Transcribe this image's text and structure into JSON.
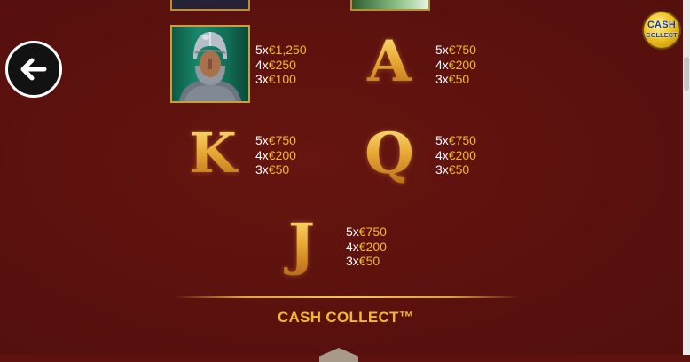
{
  "colors": {
    "background": "#5d1210",
    "gold_text": "#f3b92e",
    "white_text": "#ffffff",
    "divider": "#d9a640",
    "badge_gold": "#f2c21f",
    "badge_text": "#1b3d86"
  },
  "back_button": {
    "icon": "arrow-left-icon"
  },
  "badge": {
    "line1": "CASH",
    "line2": "COLLECT"
  },
  "symbols": {
    "knight": {
      "icon": "knight-helmet-icon",
      "payouts": [
        {
          "mult": "5x",
          "amount": "€1,250"
        },
        {
          "mult": "4x",
          "amount": "€250"
        },
        {
          "mult": "3x",
          "amount": "€100"
        }
      ]
    },
    "A": {
      "glyph": "A",
      "payouts": [
        {
          "mult": "5x",
          "amount": "€750"
        },
        {
          "mult": "4x",
          "amount": "€200"
        },
        {
          "mult": "3x",
          "amount": "€50"
        }
      ]
    },
    "K": {
      "glyph": "K",
      "payouts": [
        {
          "mult": "5x",
          "amount": "€750"
        },
        {
          "mult": "4x",
          "amount": "€200"
        },
        {
          "mult": "3x",
          "amount": "€50"
        }
      ]
    },
    "Q": {
      "glyph": "Q",
      "payouts": [
        {
          "mult": "5x",
          "amount": "€750"
        },
        {
          "mult": "4x",
          "amount": "€200"
        },
        {
          "mult": "3x",
          "amount": "€50"
        }
      ]
    },
    "J": {
      "glyph": "J",
      "payouts": [
        {
          "mult": "5x",
          "amount": "€750"
        },
        {
          "mult": "4x",
          "amount": "€200"
        },
        {
          "mult": "3x",
          "amount": "€50"
        }
      ]
    }
  },
  "section_title": "CASH COLLECT™"
}
